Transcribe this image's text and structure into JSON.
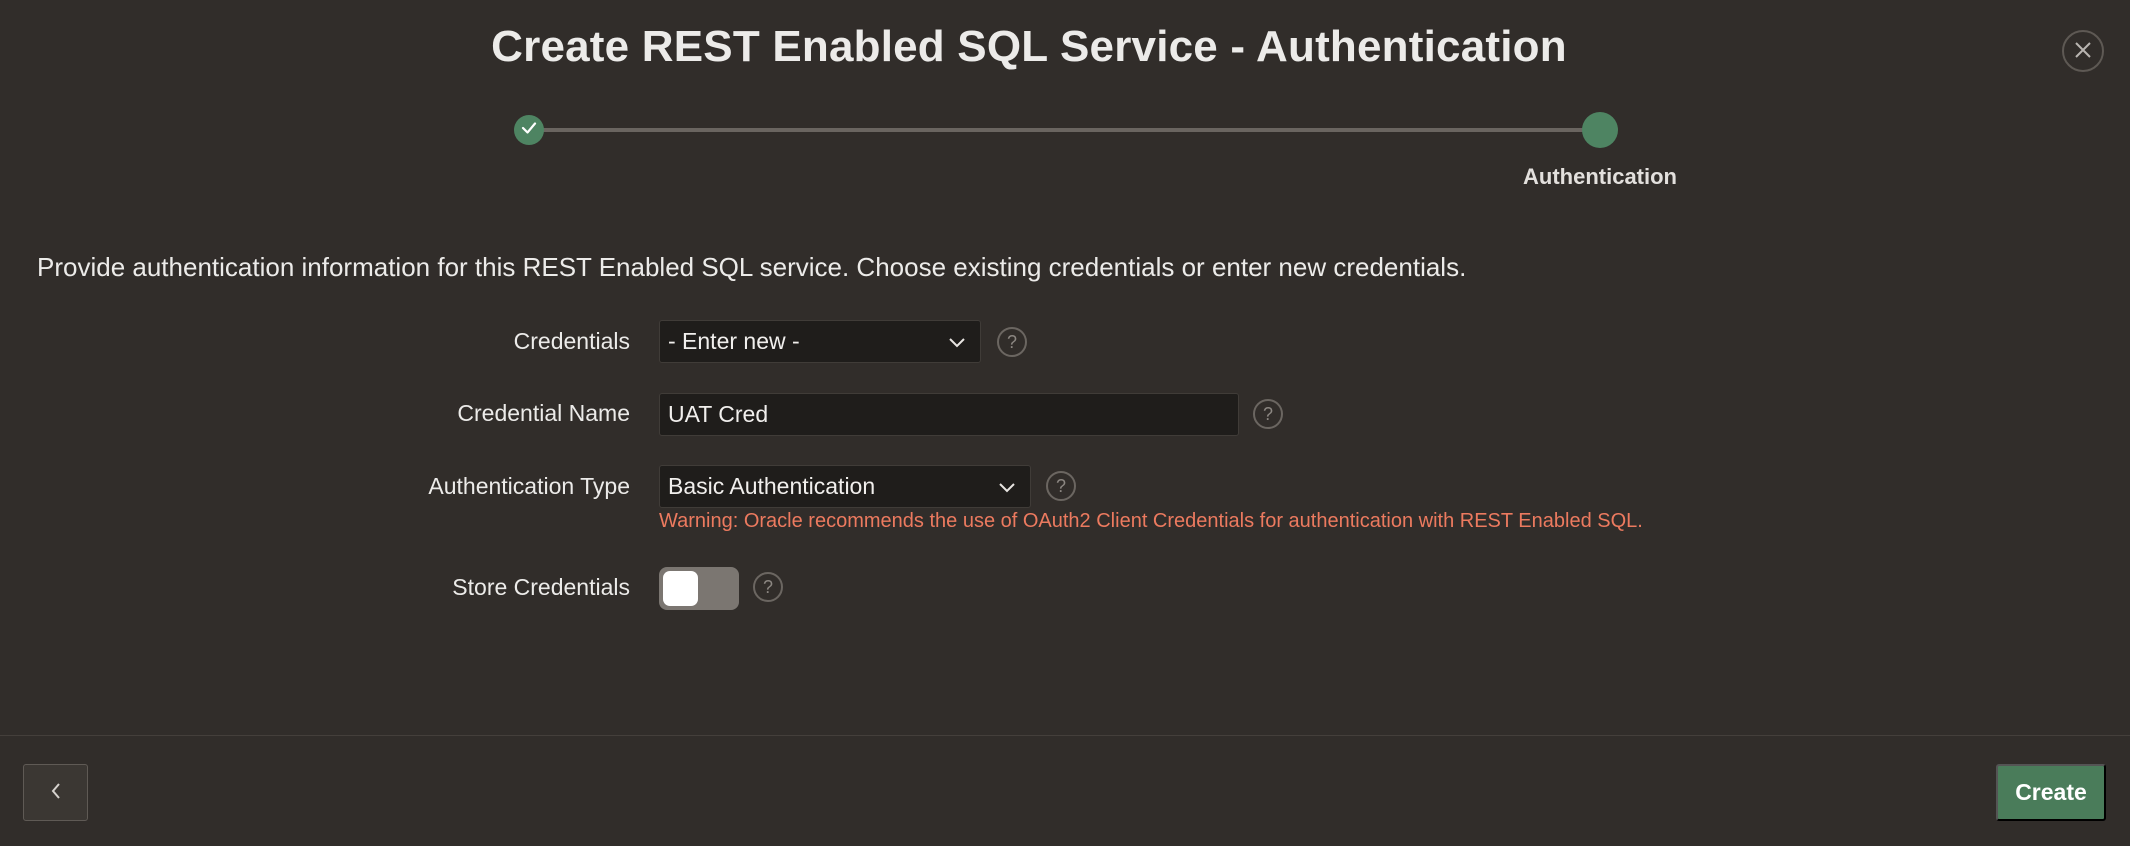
{
  "dialog": {
    "title": "Create REST Enabled SQL Service - Authentication",
    "close_icon": "close-icon"
  },
  "progress": {
    "steps": [
      {
        "label": "",
        "state": "complete",
        "icon": "check-icon"
      },
      {
        "label": "Authentication",
        "state": "current"
      }
    ]
  },
  "instructions": "Provide authentication information for this REST Enabled SQL service. Choose existing credentials or enter new credentials.",
  "form": {
    "credentials": {
      "label": "Credentials",
      "value": "- Enter new -"
    },
    "credential_name": {
      "label": "Credential Name",
      "value": "UAT Cred"
    },
    "auth_type": {
      "label": "Authentication Type",
      "value": "Basic Authentication",
      "warning": "Warning: Oracle recommends the use of OAuth2 Client Credentials for authentication with REST Enabled SQL."
    },
    "store_credentials": {
      "label": "Store Credentials",
      "on": false
    },
    "help_glyph": "?"
  },
  "footer": {
    "previous_icon": "chevron-left-icon",
    "create_label": "Create"
  },
  "colors": {
    "background": "#312d2a",
    "accent": "#4e8462",
    "warning": "#ec7a5f",
    "field": "#1f1d1b"
  }
}
